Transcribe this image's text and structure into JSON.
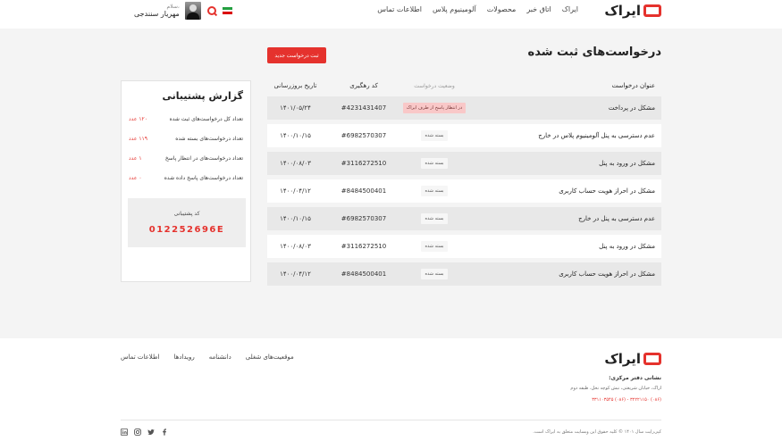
{
  "header": {
    "logo_text": "ایراک",
    "nav": [
      "ایراک",
      "اتاق خبر",
      "محصولات",
      "آلومینیوم پلاس",
      "اطلاعات تماس"
    ],
    "user_greeting": "سلام،",
    "user_name": "مهریار سنندجی"
  },
  "main": {
    "title": "درخواست‌های ثبت شده",
    "new_request_label": "ثبت درخواست جدید",
    "columns": {
      "title": "عنوان درخواست",
      "status": "وضعیت درخواست",
      "code": "کد رهگیری",
      "date": "تاریخ بروزرسانی"
    },
    "rows": [
      {
        "title": "مشکل در پرداخت",
        "status": "در انتظار پاسخ از طرف ایراک",
        "code": "#4231431407",
        "date": "۱۴۰۱/۰۵/۲۴"
      },
      {
        "title": "عدم دسترسی به پنل آلومینیوم پلاس در خارج",
        "status": "بسته شده",
        "code": "#6982570307",
        "date": "۱۴۰۰/۱۰/۱۵"
      },
      {
        "title": "مشکل در ورود به پنل",
        "status": "بسته شده",
        "code": "#3116272510",
        "date": "۱۴۰۰/۰۸/۰۳"
      },
      {
        "title": "مشکل در احراز هویت حساب کاربری",
        "status": "بسته شده",
        "code": "#8484500401",
        "date": "۱۴۰۰/۰۴/۱۲"
      },
      {
        "title": "عدم دسترسی به پنل در خارج",
        "status": "بسته شده",
        "code": "#6982570307",
        "date": "۱۴۰۰/۱۰/۱۵"
      },
      {
        "title": "مشکل در ورود به پنل",
        "status": "بسته شده",
        "code": "#3116272510",
        "date": "۱۴۰۰/۰۸/۰۳"
      },
      {
        "title": "مشکل در احراز هویت حساب کاربری",
        "status": "بسته شده",
        "code": "#8484500401",
        "date": "۱۴۰۰/۰۴/۱۲"
      }
    ]
  },
  "panel": {
    "title": "گزارش پشتیبانی",
    "stats": [
      {
        "label": "تعداد کل درخواست‌های ثبت شده",
        "value": "۱۲۰ عدد"
      },
      {
        "label": "تعداد درخواست‌های بسته شده",
        "value": "۱۱۹ عدد"
      },
      {
        "label": "تعداد درخواست‌های در انتظار پاسخ",
        "value": "۱ عدد"
      },
      {
        "label": "تعداد درخواست‌های پاسخ داده شده",
        "value": "۰ عدد"
      }
    ],
    "support_code_label": "کد پشتیبانی",
    "support_code": "012252696E"
  },
  "footer": {
    "logo_text": "ایراک",
    "links": [
      "موقعیت‌های شغلی",
      "دانشنامه",
      "رویدادها",
      "اطلاعات تماس"
    ],
    "address_title": "نشانی دفتر مرکزی:",
    "address": "اراک، خیابان شریعتی، نبش کوچه نخل، طبقه دوم",
    "phones": "(۰۸۶) ۳۲۲۲۱۱۵۰ - (۰۸۶) ۳۳۱۱۰۳۵۴۵",
    "copyright": "کپی‌رایت سال ۱۴۰۱ © کلیه حقوق این وبسایت متعلق به ایراک است."
  },
  "colors": {
    "accent": "#e5322d",
    "flag_green": "#239f40",
    "flag_white": "#ffffff",
    "flag_red": "#da0000"
  }
}
